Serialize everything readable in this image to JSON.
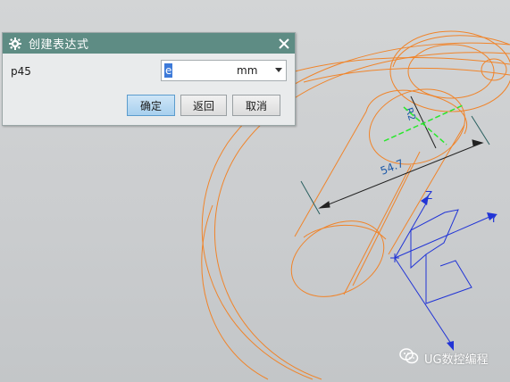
{
  "dialog": {
    "title": "创建表达式",
    "param_name": "p45",
    "expression_value": "e",
    "unit": "mm",
    "buttons": {
      "ok": "确定",
      "back": "返回",
      "cancel": "取消"
    }
  },
  "viewport": {
    "dimensions": {
      "length": "54.7",
      "radius": "R2"
    },
    "axes": {
      "y": "Y",
      "z": "Z"
    }
  },
  "watermark": {
    "text": "UG数控编程"
  },
  "colors": {
    "titlebar": "#5e8c84",
    "model_lines": "#f0842a",
    "csys": "#2134d6",
    "centerline": "#29e82c",
    "dimension": "#1e5aa8",
    "selection": "#3d7ad9"
  },
  "icons": {
    "dialog": "gear-icon",
    "close": "close-icon",
    "dropdown": "chevron-down-icon",
    "watermark": "chat-icon"
  }
}
